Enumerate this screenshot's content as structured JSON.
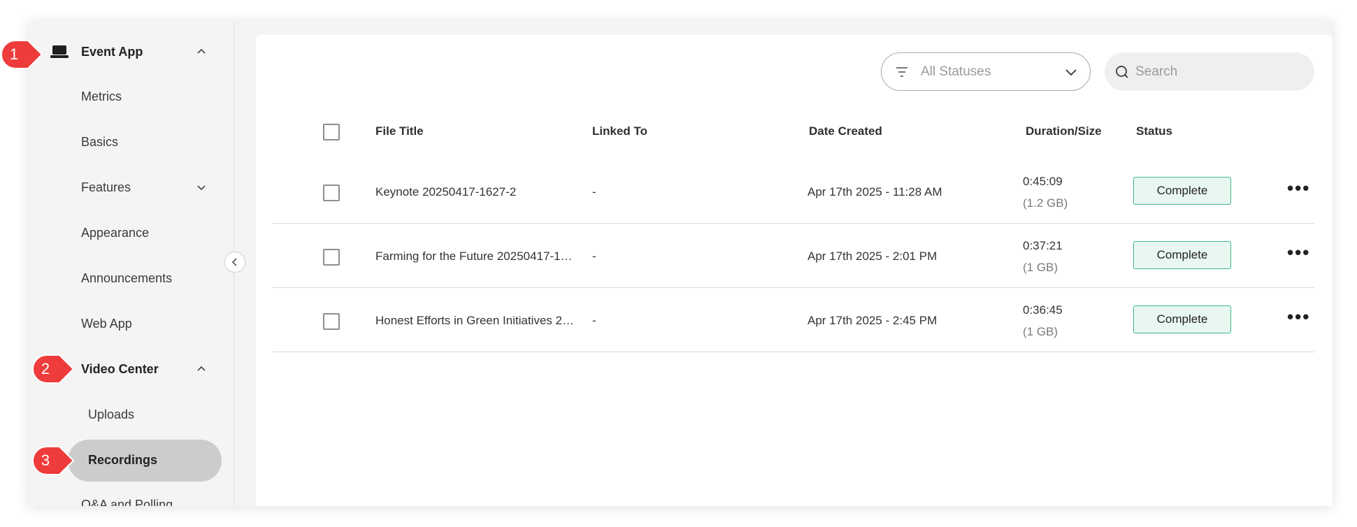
{
  "sidebar": {
    "items": [
      {
        "label": "Event App"
      },
      {
        "label": "Metrics"
      },
      {
        "label": "Basics"
      },
      {
        "label": "Features"
      },
      {
        "label": "Appearance"
      },
      {
        "label": "Announcements"
      },
      {
        "label": "Web App"
      },
      {
        "label": "Video Center"
      },
      {
        "label": "Uploads"
      },
      {
        "label": "Recordings"
      },
      {
        "label": "Q&A and Polling"
      }
    ]
  },
  "toolbar": {
    "status_filter": "All Statuses",
    "search_placeholder": "Search"
  },
  "table": {
    "headers": {
      "file_title": "File Title",
      "linked_to": "Linked To",
      "date_created": "Date Created",
      "duration_size": "Duration/Size",
      "status": "Status"
    },
    "rows": [
      {
        "title": "Keynote 20250417-1627-2",
        "linked": "-",
        "date": "Apr 17th 2025 - 11:28 AM",
        "duration": "0:45:09",
        "size": "(1.2 GB)",
        "status": "Complete",
        "more": "•••"
      },
      {
        "title": "Farming for the Future 20250417-1…",
        "linked": "-",
        "date": "Apr 17th 2025 - 2:01 PM",
        "duration": "0:37:21",
        "size": "(1 GB)",
        "status": "Complete",
        "more": "•••"
      },
      {
        "title": "Honest Efforts in Green Initiatives 2…",
        "linked": "-",
        "date": "Apr 17th 2025 - 2:45 PM",
        "duration": "0:36:45",
        "size": "(1 GB)",
        "status": "Complete",
        "more": "•••"
      }
    ]
  },
  "markers": [
    "1",
    "2",
    "3"
  ],
  "colors": {
    "status_border": "#3cb88a",
    "status_bg": "#e9f7f1",
    "marker": "#ee3b3b",
    "active_pill": "#cccccc"
  }
}
